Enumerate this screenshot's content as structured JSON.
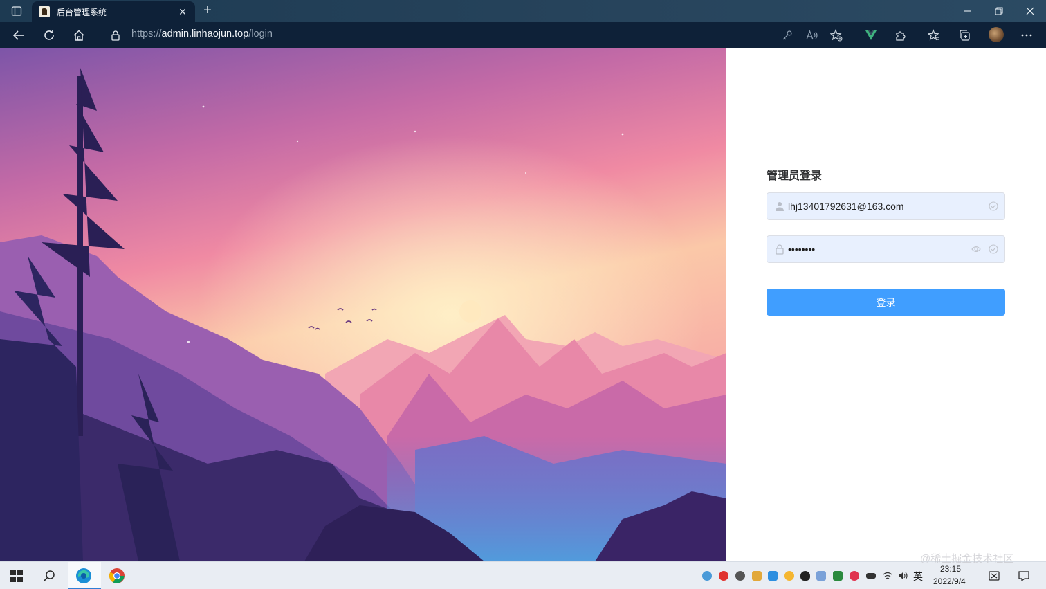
{
  "browser": {
    "tab_title": "后台管理系统",
    "url_scheme": "https://",
    "url_host": "admin.linhaojun.top",
    "url_path": "/login"
  },
  "login": {
    "title": "管理员登录",
    "email_value": "lhj13401792631@163.com",
    "password_value": "••••••••",
    "submit_label": "登录"
  },
  "taskbar": {
    "input_language": "英",
    "time": "23:15",
    "date": "2022/9/4"
  },
  "watermark": "@稀土掘金技术社区",
  "colors": {
    "primary_button": "#409eff",
    "input_autofill_bg": "#e8f0fe",
    "browser_chrome": "#0e2138"
  },
  "icons": {
    "email_field": "user-icon",
    "password_field": "lock-icon",
    "show_password": "eye-icon",
    "valid": "check-circle-icon"
  }
}
